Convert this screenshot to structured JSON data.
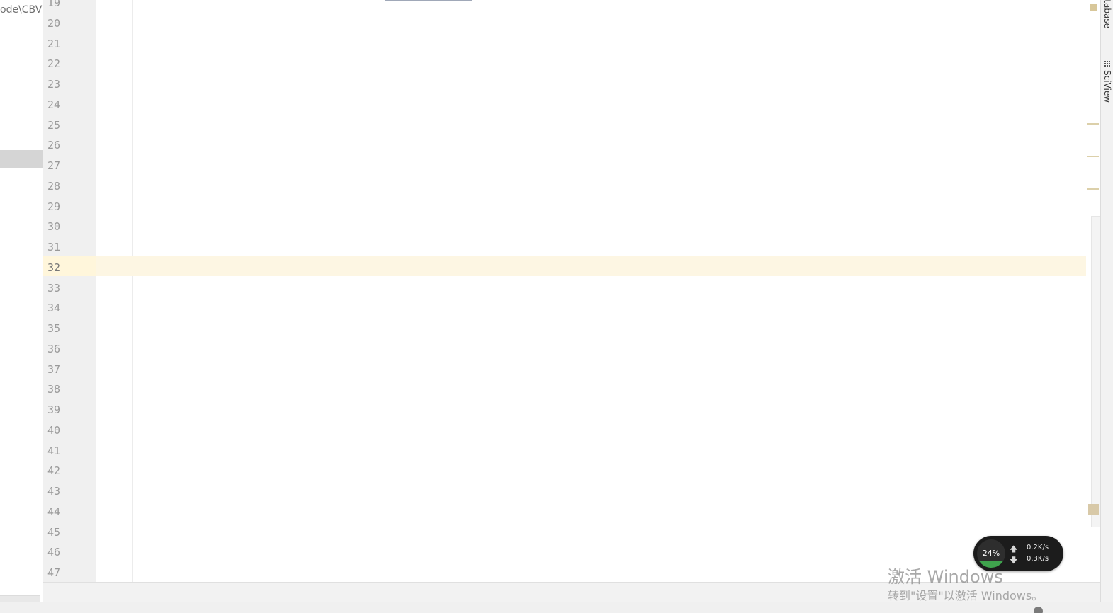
{
  "project_panel": {
    "path_fragment": "ode\\CBV"
  },
  "gutter": {
    "line_numbers": [
      "19",
      "20",
      "21",
      "22",
      "23",
      "24",
      "25",
      "26",
      "27",
      "28",
      "29",
      "30",
      "31",
      "32",
      "33",
      "34",
      "35",
      "36",
      "37",
      "38",
      "39",
      "40",
      "41",
      "42",
      "43",
      "44",
      "45",
      "46",
      "47"
    ],
    "current_line": "32"
  },
  "right_tool_strip": {
    "tabs": [
      {
        "label": "atabase"
      },
      {
        "label": "SciView",
        "icon": "grid-icon"
      }
    ]
  },
  "status_bar": {
    "left_text": "",
    "right_text": ""
  },
  "watermark": {
    "title": "激活 Windows",
    "subtitle": "转到\"设置\"以激活 Windows。"
  },
  "net_monitor": {
    "usage_percent": "24%",
    "usage_fraction": 0.24,
    "upload": "0.2K/s",
    "download": "0.3K/s",
    "fill_color": "#3fa34d"
  },
  "colors": {
    "current_line_bg": "#fdf6e3",
    "gutter_bg": "#f0f0f0",
    "editor_bg": "#ffffff"
  }
}
